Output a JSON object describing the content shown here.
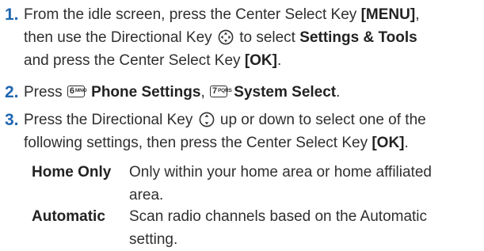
{
  "steps": [
    {
      "number": "1.",
      "l1_a": "From the idle screen, press the Center Select Key ",
      "l1_b": "[MENU]",
      "l1_c": ",",
      "l2_a": "then use the Directional Key ",
      "l2_b": " to select ",
      "l2_c": "Settings & Tools",
      "l3_a": "and press the Center Select Key ",
      "l3_b": "[OK]",
      "l3_c": "."
    },
    {
      "number": "2.",
      "a": "Press ",
      "key1_digit": "6",
      "key1_letters": "MNO",
      "b": "Phone Settings",
      "c": ", ",
      "key2_digit": "7",
      "key2_letters": "PQRS",
      "d": "System Select",
      "e": "."
    },
    {
      "number": "3.",
      "l1_a": "Press the Directional Key ",
      "l1_b": " up or down to select one of the",
      "l2_a": "following settings, then press the Center Select Key ",
      "l2_b": "[OK]",
      "l2_c": "."
    }
  ],
  "options": [
    {
      "term": "Home Only",
      "line1": "Only within your home area or home affiliated",
      "line2": "area."
    },
    {
      "term": "Automatic",
      "line1": "Scan radio channels based on the Automatic",
      "line2": "setting."
    }
  ],
  "icons": {
    "directional_4way": "directional-key-4way-icon",
    "directional_updown": "directional-key-updown-icon"
  },
  "colors": {
    "step_number": "#1f67b1",
    "text": "#2f2f2f"
  }
}
